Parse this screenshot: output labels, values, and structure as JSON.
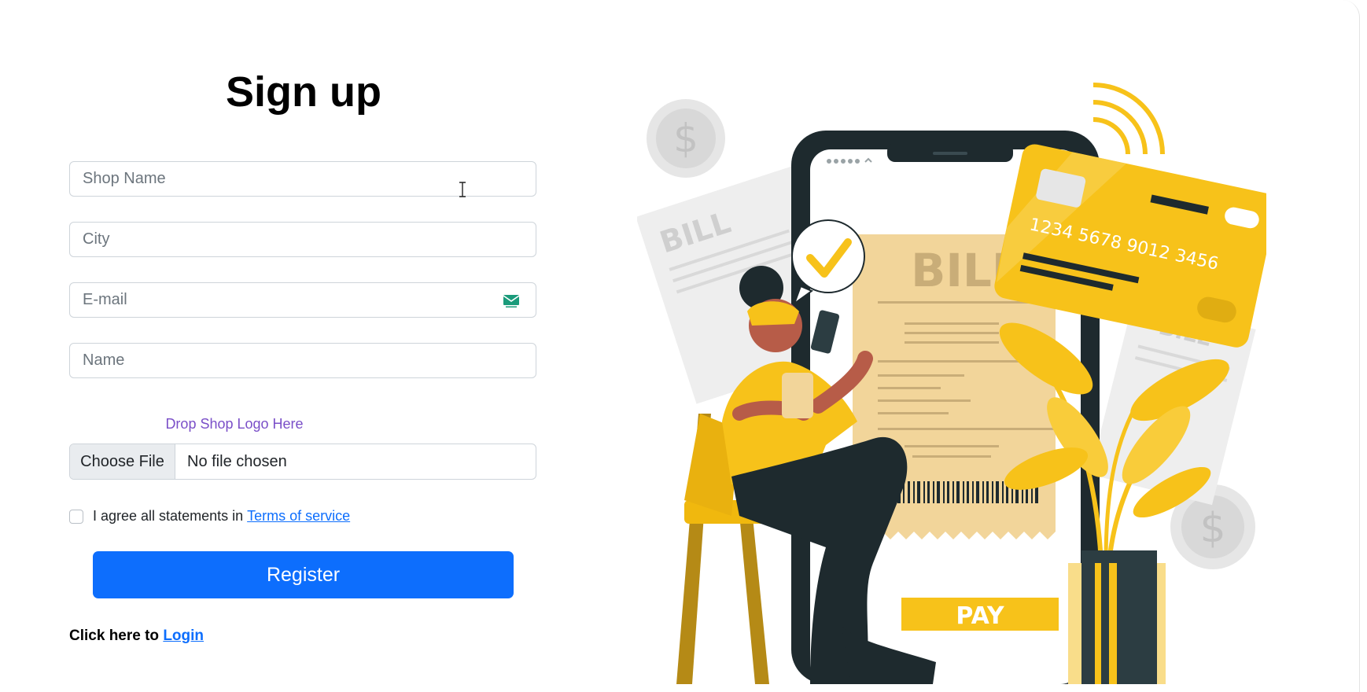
{
  "form": {
    "title": "Sign up",
    "fields": {
      "shop_name": {
        "placeholder": "Shop Name",
        "value": ""
      },
      "city": {
        "placeholder": "City",
        "value": ""
      },
      "email": {
        "placeholder": "E-mail",
        "value": ""
      },
      "name": {
        "placeholder": "Name",
        "value": ""
      }
    },
    "logo_drop_text": "Drop Shop Logo Here",
    "file_input": {
      "button_label": "Choose File",
      "status": "No file chosen"
    },
    "agree": {
      "text": "I agree all statements in",
      "link": "Terms of service",
      "checked": false
    },
    "register_label": "Register",
    "login": {
      "prefix": "Click here to",
      "link": "Login"
    }
  },
  "illustration": {
    "bill_main": "BILL",
    "bill_left": "BILL",
    "bill_right": "BILL",
    "card_number": "1234  5678  9012  3456",
    "pay_label": "PAY",
    "icons": [
      "dollar-coin-icon",
      "checkmark-icon",
      "wifi-icon",
      "mail-icon"
    ]
  },
  "colors": {
    "accent": "#0d6efd",
    "drop_text": "#7a4fc8",
    "illustration_yellow": "#f7c21a",
    "bill_paper": "#f2d59a",
    "dark": "#1e2a2e"
  }
}
